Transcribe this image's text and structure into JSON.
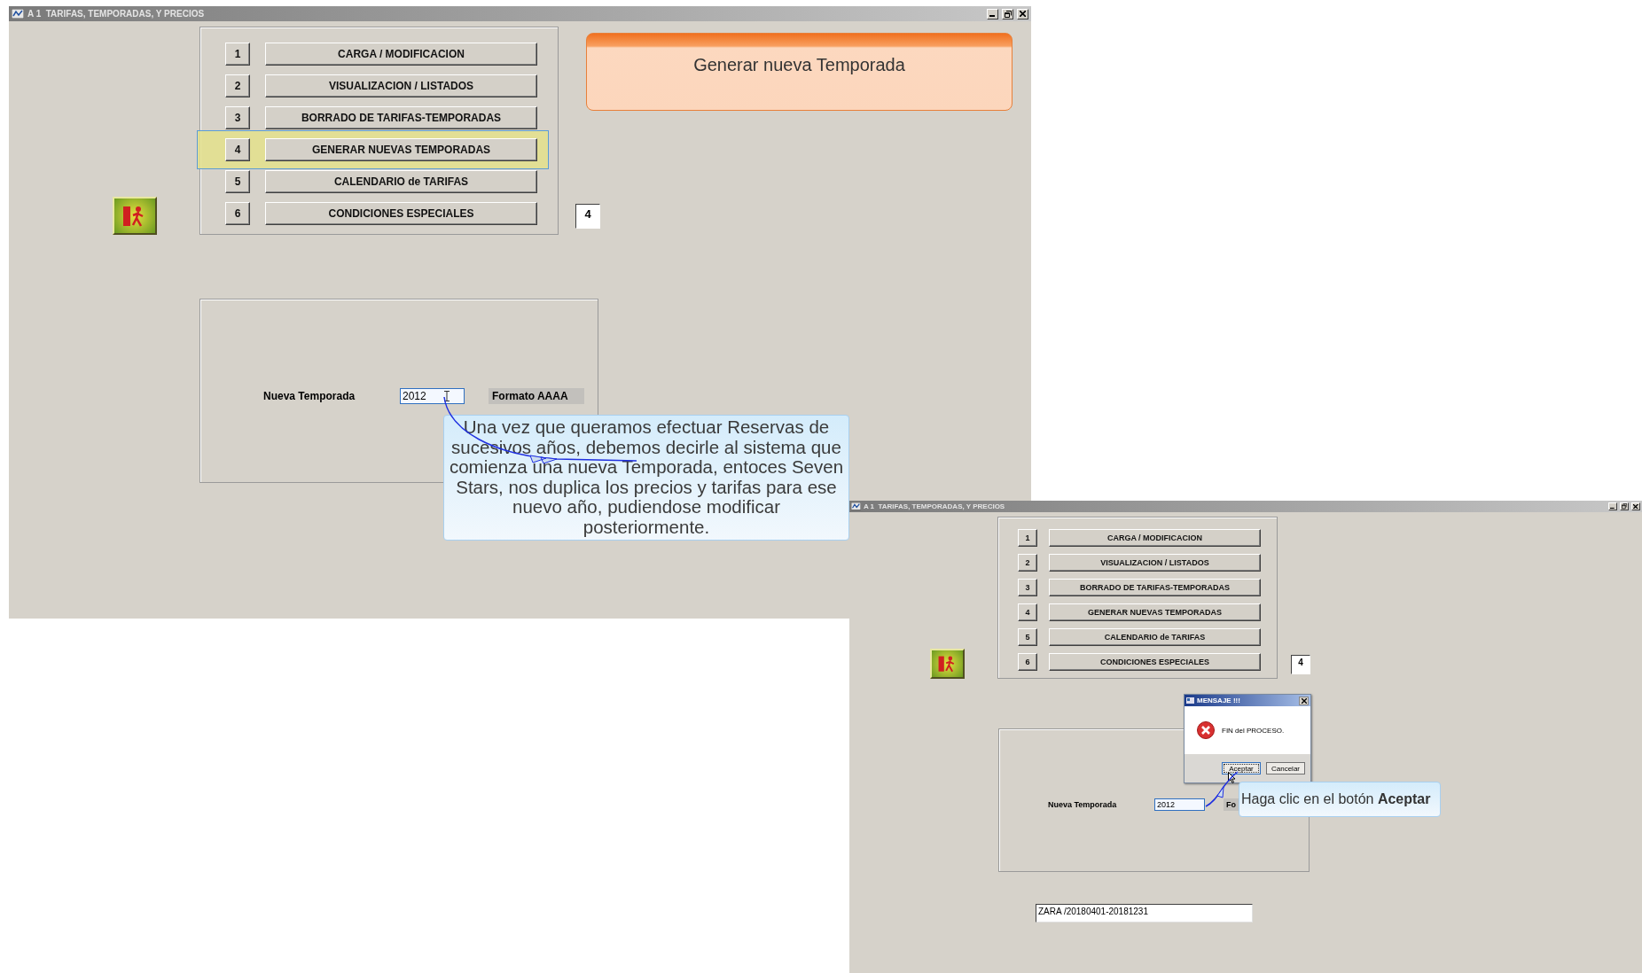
{
  "main_window": {
    "title": "A 1  TARIFAS, TEMPORADAS, Y PRECIOS",
    "menu": [
      {
        "number": "1",
        "label": "CARGA / MODIFICACION",
        "selected": false
      },
      {
        "number": "2",
        "label": "VISUALIZACION / LISTADOS",
        "selected": false
      },
      {
        "number": "3",
        "label": "BORRADO DE TARIFAS-TEMPORADAS",
        "selected": false
      },
      {
        "number": "4",
        "label": "GENERAR NUEVAS TEMPORADAS",
        "selected": true
      },
      {
        "number": "5",
        "label": "CALENDARIO de TARIFAS",
        "selected": false
      },
      {
        "number": "6",
        "label": "CONDICIONES ESPECIALES",
        "selected": false
      }
    ],
    "option_box": "4",
    "header": "Generar nueva Temporada",
    "season_label": "Nueva Temporada",
    "season_value": "2012",
    "format_label": "Formato AAAA"
  },
  "callout": "Una vez que queramos efectuar Reservas de sucesivos años, debemos decirle al sistema que comienza una nueva Temporada, entoces Seven Stars, nos duplica los precios y tarifas para ese nuevo año, pudiendose modificar posteriormente.",
  "second_window": {
    "title": "A 1  TARIFAS, TEMPORADAS, Y PRECIOS",
    "menu": [
      {
        "number": "1",
        "label": "CARGA / MODIFICACION",
        "selected": false
      },
      {
        "number": "2",
        "label": "VISUALIZACION / LISTADOS",
        "selected": false
      },
      {
        "number": "3",
        "label": "BORRADO DE TARIFAS-TEMPORADAS",
        "selected": false
      },
      {
        "number": "4",
        "label": "GENERAR NUEVAS TEMPORADAS",
        "selected": false
      },
      {
        "number": "5",
        "label": "CALENDARIO de TARIFAS",
        "selected": false
      },
      {
        "number": "6",
        "label": "CONDICIONES ESPECIALES",
        "selected": false
      }
    ],
    "option_box": "4",
    "season_label": "Nueva Temporada",
    "season_value": "2012",
    "format_label": "Fo",
    "result_value": "ZARA /20180401-20181231",
    "dialog": {
      "title": "MENSAJE !!!",
      "message": "FIN del PROCESO.",
      "buttons": [
        "Aceptar",
        "Cancelar"
      ]
    }
  },
  "hint": "Haga clic en el botón **Aceptar**"
}
